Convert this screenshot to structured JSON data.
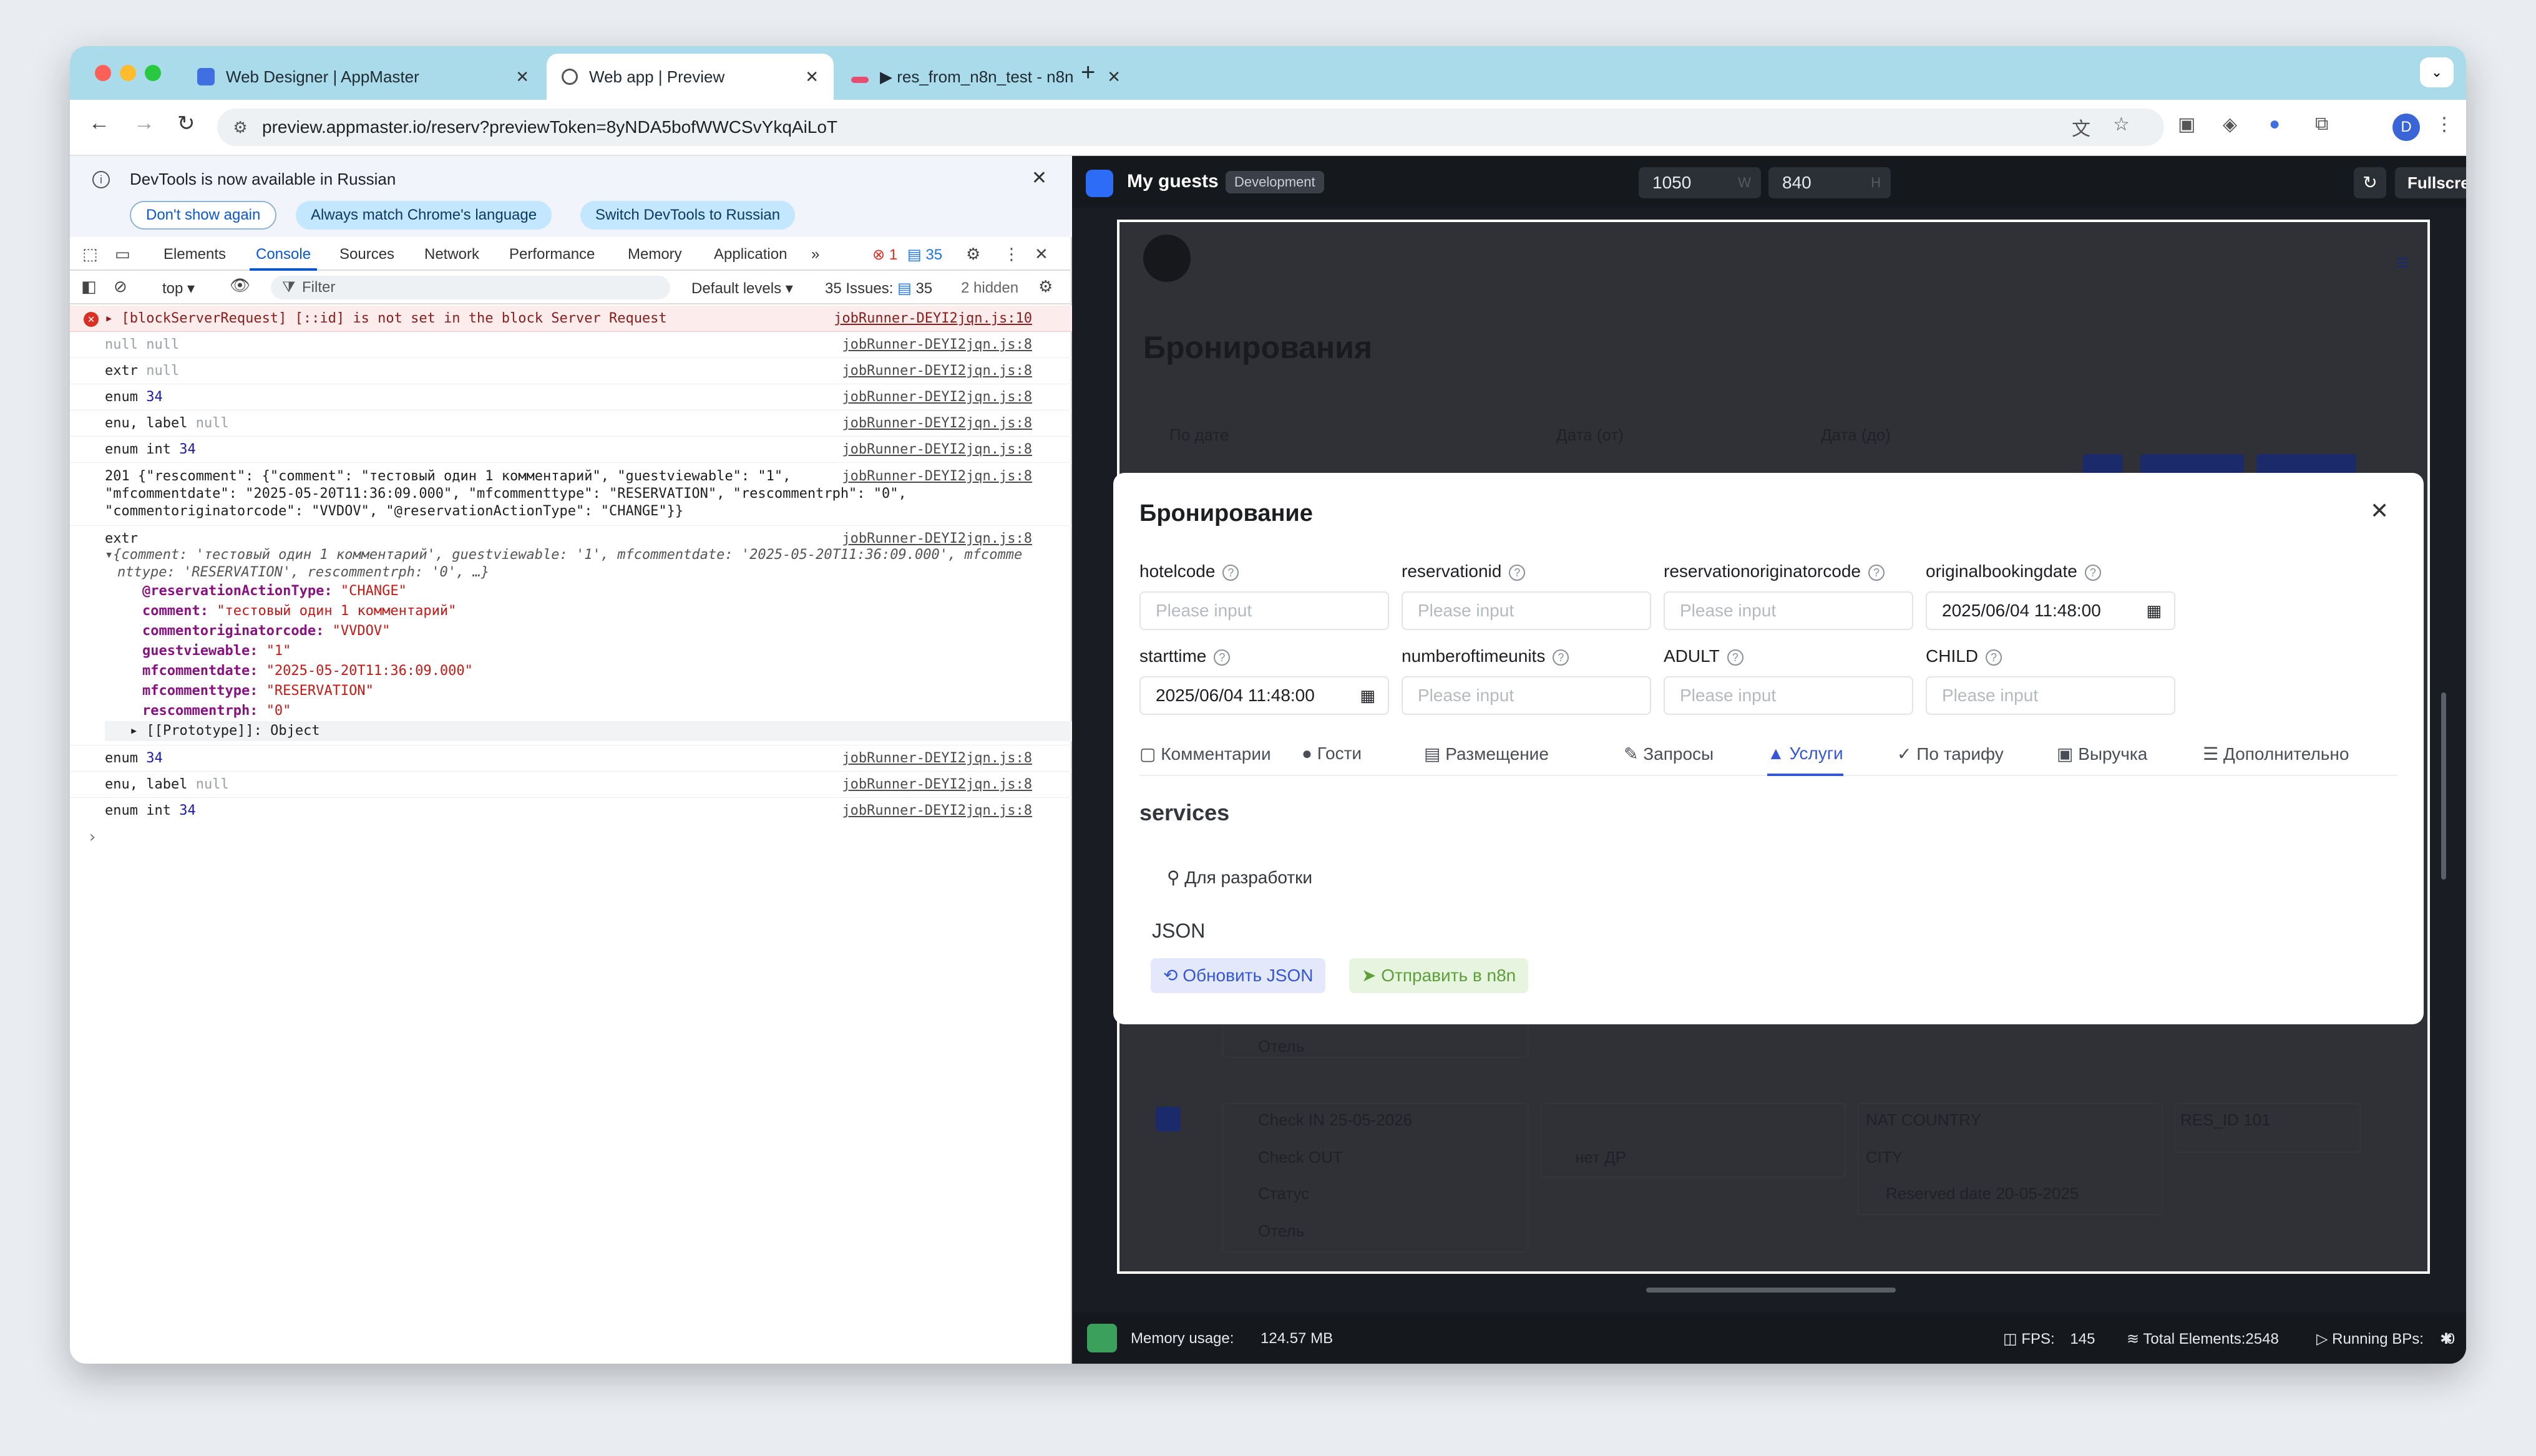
{
  "browser": {
    "tabs": [
      {
        "label": "Web Designer | AppMaster",
        "active": false
      },
      {
        "label": "Web app | Preview",
        "active": true
      },
      {
        "label": "▶ res_from_n8n_test - n8n",
        "active": false
      }
    ],
    "url": "preview.appmaster.io/reserv?previewToken=8yNDA5bofWWCSvYkqAiLoT",
    "profile_initial": "D"
  },
  "devtools": {
    "infobar": {
      "message": "DevTools is now available in Russian",
      "dont_show": "Don't show again",
      "match_language": "Always match Chrome's language",
      "switch": "Switch DevTools to Russian"
    },
    "tabs": [
      "Elements",
      "Console",
      "Sources",
      "Network",
      "Performance",
      "Memory",
      "Application"
    ],
    "active_tab": "Console",
    "error_count": "1",
    "message_count": "35",
    "toolbar": {
      "context": "top ▾",
      "filter_placeholder": "Filter",
      "levels": "Default levels ▾",
      "issues": "35 Issues:",
      "issues_count": "35",
      "hidden": "2 hidden"
    },
    "console": {
      "error": {
        "text": "▸ [blockServerRequest] [::id] is not set in the block Server Request",
        "src": "jobRunner-DEYI2jqn.js:10"
      },
      "src": "jobRunner-DEYI2jqn.js:8",
      "rows": [
        {
          "a": "null",
          "b": "null"
        },
        {
          "a": "extr",
          "b": "null"
        },
        {
          "a": "enum",
          "b": "34"
        },
        {
          "a": "enu, label",
          "b": "null"
        },
        {
          "a": "enum int",
          "b": "34"
        }
      ],
      "long_line1": "201 {\"rescomment\": {\"comment\": \"тестовый один 1 комментарий\", \"guestviewable\": \"1\",",
      "long_line2": "\"mfcommentdate\": \"2025-05-20T11:36:09.000\", \"mfcommenttype\": \"RESERVATION\", \"rescommentrph\": \"0\",",
      "long_line3": "\"commentoriginatorcode\": \"VVDOV\", \"@reservationActionType\": \"CHANGE\"}}",
      "extr": "extr",
      "obj_summary1": "▾{comment: 'тестовый один 1 комментарий', guestviewable: '1', mfcommentdate: '2025-05-20T11:36:09.000', mfcomme",
      "obj_summary2": "nttype: 'RESERVATION', rescommentrph: '0', …}",
      "props": [
        {
          "k": "@reservationActionType:",
          "v": "\"CHANGE\""
        },
        {
          "k": "comment:",
          "v": "\"тестовый один 1 комментарий\""
        },
        {
          "k": "commentoriginatorcode:",
          "v": "\"VVDOV\""
        },
        {
          "k": "guestviewable:",
          "v": "\"1\""
        },
        {
          "k": "mfcommentdate:",
          "v": "\"2025-05-20T11:36:09.000\""
        },
        {
          "k": "mfcommenttype:",
          "v": "\"RESERVATION\""
        },
        {
          "k": "rescommentrph:",
          "v": "\"0\""
        }
      ],
      "prototype": "▸ [[Prototype]]: Object",
      "rows2": [
        {
          "a": "enum",
          "b": "34"
        },
        {
          "a": "enu, label",
          "b": "null"
        },
        {
          "a": "enum int",
          "b": "34"
        }
      ]
    }
  },
  "preview": {
    "app_name": "My guests",
    "env_badge": "Development",
    "width": "1050",
    "width_unit": "W",
    "height": "840",
    "height_unit": "H",
    "fullscreen": "Fullscreen",
    "background": {
      "title": "Бронирования",
      "by_date": "По дате",
      "date_from": "Дата (от)",
      "date_to": "Дата (до)",
      "hotel": "Отель",
      "checkin": "Check IN 25-05-2026",
      "checkout": "Check OUT",
      "status": "Статус",
      "hotel2": "Отель",
      "nat": "NAT  COUNTRY",
      "city": "CITY",
      "reserved": "Reserved date 20-05-2025",
      "res_id": "RES_ID 101",
      "no_dr": "нет ДР"
    },
    "modal": {
      "title": "Бронирование",
      "fields": [
        {
          "label": "hotelcode",
          "placeholder": "Please input",
          "value": ""
        },
        {
          "label": "reservationid",
          "placeholder": "Please input",
          "value": ""
        },
        {
          "label": "reservationoriginatorcode",
          "placeholder": "Please input",
          "value": ""
        },
        {
          "label": "originalbookingdate",
          "placeholder": "",
          "value": "2025/06/04 11:48:00"
        },
        {
          "label": "starttime",
          "placeholder": "",
          "value": "2025/06/04 11:48:00"
        },
        {
          "label": "numberoftimeunits",
          "placeholder": "Please input",
          "value": ""
        },
        {
          "label": "ADULT",
          "placeholder": "Please input",
          "value": ""
        },
        {
          "label": "CHILD",
          "placeholder": "Please input",
          "value": ""
        }
      ],
      "tabs": [
        "Комментарии",
        "Гости",
        "Размещение",
        "Запросы",
        "Услуги",
        "По тарифу",
        "Выручка",
        "Дополнительно"
      ],
      "active_tab": "Услуги",
      "section": "services",
      "dev_label": "Для разработки",
      "json_label": "JSON",
      "refresh_btn": "Обновить JSON",
      "send_btn": "Отправить в n8n"
    },
    "footer": {
      "memory_label": "Memory usage:",
      "memory_value": "124.57 MB",
      "fps_label": "FPS:",
      "fps_value": "145",
      "elements": "Total Elements:2548",
      "bps_label": "Running BPs:",
      "bps_value": "0"
    }
  },
  "colors": {
    "accent": "#3556d6",
    "error": "#d93025",
    "tabbar": "#a9dbea"
  }
}
